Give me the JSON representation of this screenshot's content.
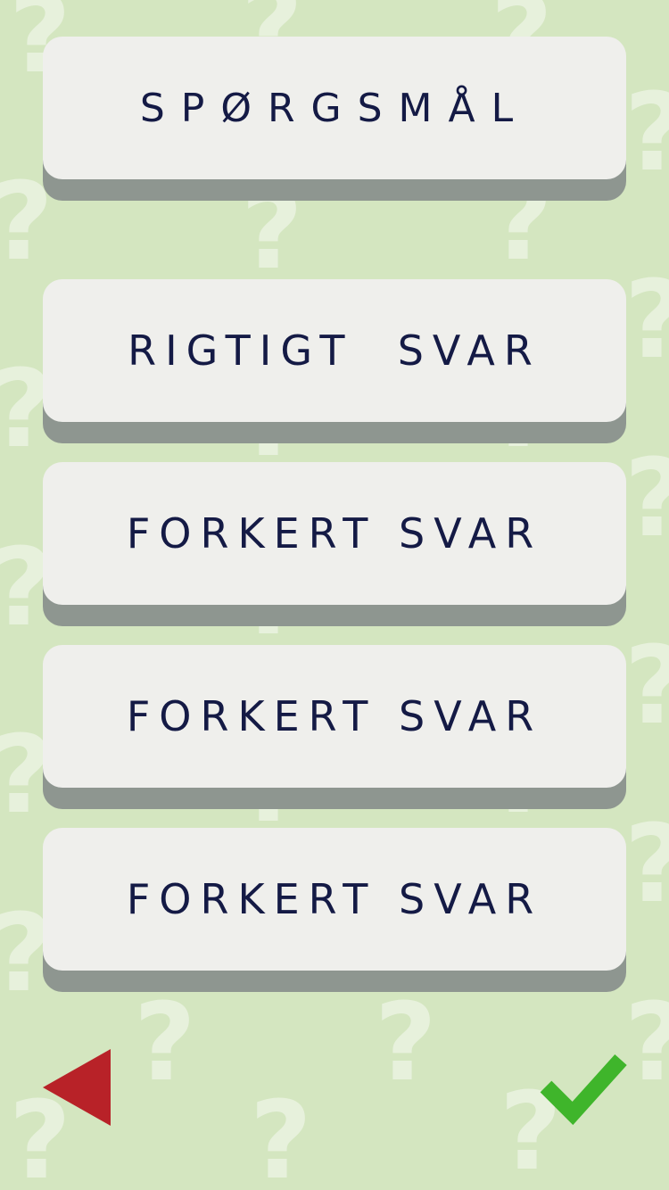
{
  "question": {
    "label": "SPØRGSMÅL"
  },
  "answers": [
    {
      "label": "RIGTIGT  SVAR"
    },
    {
      "label": "FORKERT SVAR"
    },
    {
      "label": "FORKERT SVAR"
    },
    {
      "label": "FORKERT SVAR"
    }
  ],
  "navigation": {
    "back_icon": "back-triangle-icon",
    "confirm_icon": "checkmark-icon"
  },
  "colors": {
    "background": "#d4e6c0",
    "card": "#efefec",
    "card_shadow": "#8e9690",
    "text": "#141a45",
    "back_button": "#b82228",
    "confirm_button": "#3fb52b"
  }
}
